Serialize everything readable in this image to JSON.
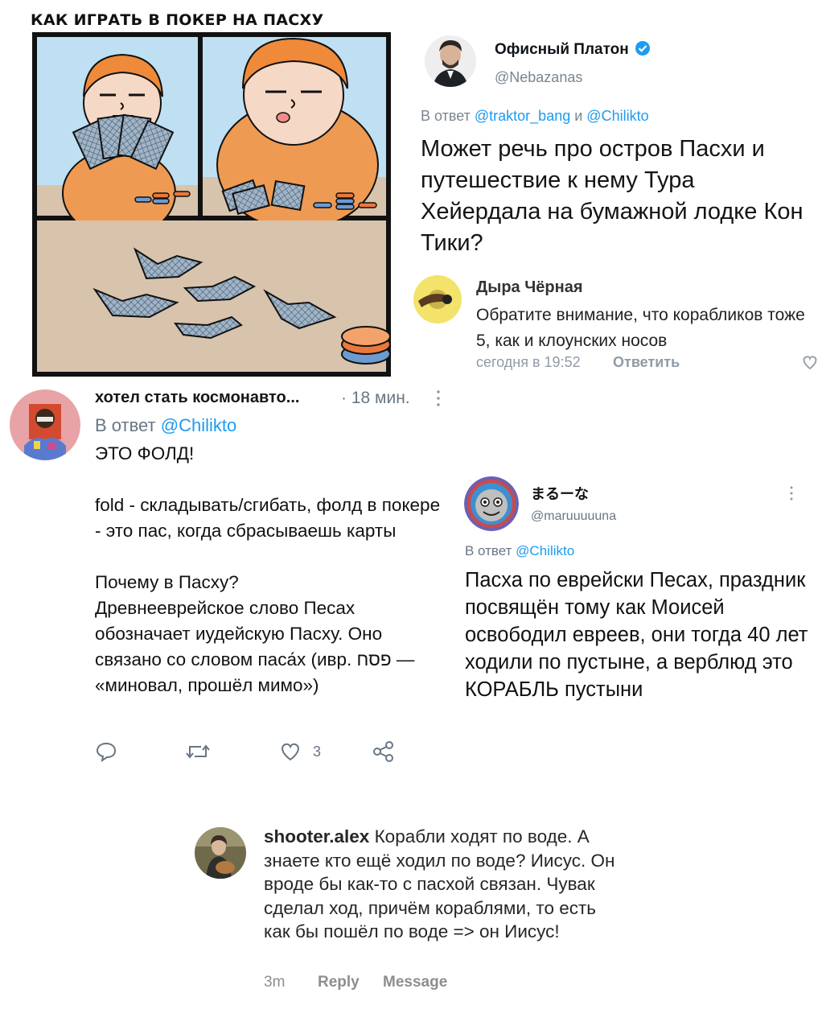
{
  "comic": {
    "title": "КАК ИГРАТЬ В ПОКЕР НА ПАСХУ"
  },
  "tweet1": {
    "name": "Офисный Платон",
    "handle": "@Nebazanas",
    "reply_prefix": "В ответ ",
    "reply_user1": "@traktor_bang",
    "reply_and": " и ",
    "reply_user2": "@Chilikto",
    "text": "Может речь про остров Пасхи и путешествие к нему Тура Хейердала на бумажной лодке Кон Тики?",
    "verified_color": "#1d9bf0"
  },
  "vk_comment": {
    "name": "Дыра Чёрная",
    "text": "Обратите внимание, что корабликов тоже 5, как и клоунских носов",
    "time": "сегодня в 19:52",
    "reply_label": "Ответить"
  },
  "tweet2": {
    "name": "хотел стать космонавто...",
    "time": "· 18 мин.",
    "reply_prefix": "В ответ ",
    "reply_user": "@Chilikto",
    "text": "ЭТО ФОЛД!\n\nfold - складывать/сгибать, фолд в покере - это пас, когда сбрасываешь карты\n\nПочему в Пасху?\nДревнееврейское слово Песах обозначает иудейскую Пасху. Оно связано со словом паса́х (ивр. פסח — «миновал, прошёл мимо»)",
    "likes": "3",
    "actions": [
      "reply-icon",
      "retweet-icon",
      "like-icon",
      "share-icon"
    ]
  },
  "tweet3": {
    "name": "まるーな",
    "handle": "@maruuuuuna",
    "reply_prefix": "В ответ ",
    "reply_user": "@Chilikto",
    "text": "Пасха по еврейски Песах, праздник посвящён тому как Моисей освободил евреев, они тогда 40 лет ходили по пустыне, а верблюд это КОРАБЛЬ пустыни"
  },
  "instagram_comment": {
    "username": "shooter.alex",
    "text": "Корабли ходят по воде. А знаете кто ещё ходил по воде? Иисус. Он вроде бы как-то с пасхой связан. Чувак сделал ход, причём кораблями, то есть как бы пошёл по воде => он Иисус!",
    "time": "3m",
    "reply_label": "Reply",
    "message_label": "Message"
  }
}
